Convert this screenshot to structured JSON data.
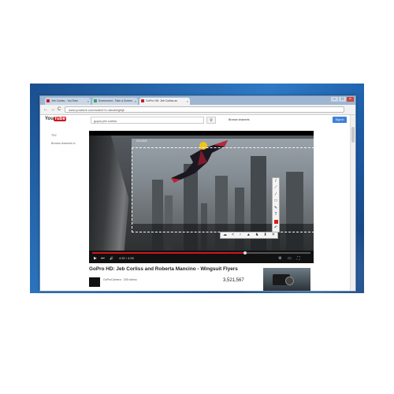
{
  "browser": {
    "tabs": [
      {
        "label": "Jeb Corliss - YouTube"
      },
      {
        "label": "Screenshot - Take a Screen"
      },
      {
        "label": "GoPro HD: Jeb Corliss an"
      }
    ],
    "window_buttons": {
      "minimize": "–",
      "maximize": "□",
      "close": "×"
    },
    "nav": {
      "back": "←",
      "forward": "→",
      "reload": "C"
    },
    "url": "www.youtube.com/watch?v=abcdefghijk"
  },
  "youtube": {
    "logo_you": "You",
    "logo_tube": "Tube",
    "search_value": "gopro jeb corliss",
    "search_icon": "⚲",
    "browse": "Browse channels",
    "signin": "Sign in",
    "sidebar": [
      "TRY",
      "Browse channels to"
    ]
  },
  "capture": {
    "size_label": "522x306",
    "vertical_tools": [
      "/",
      "⟋",
      "⁄",
      "□",
      "✎",
      "T"
    ],
    "horizontal_tools": [
      "☁",
      "<",
      "♀",
      "▲",
      "♞",
      "⬇",
      "✕"
    ],
    "accent_color": "#e01b1b"
  },
  "player": {
    "time": "4:52 / 4:59",
    "progress_fraction": 0.7,
    "play_icon": "▶",
    "next_icon": "⏭",
    "volume_icon": "🔊"
  },
  "video": {
    "title": "GoPro HD: Jeb Corliss and Roberta Mancino - Wingsuit Flyers",
    "channel": "GoProCamera · 155 videos",
    "views": "3,521,567"
  }
}
